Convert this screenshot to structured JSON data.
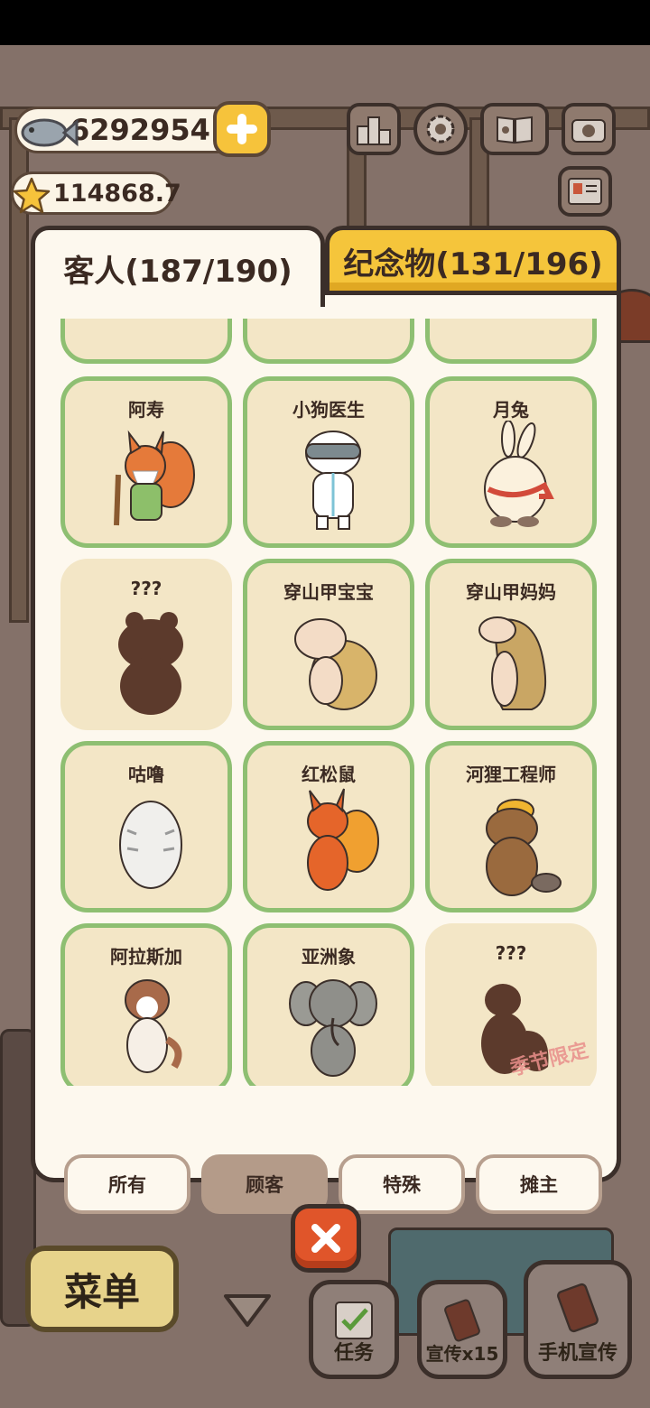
{
  "currency": {
    "fish": "6292954",
    "stars": "114868.7"
  },
  "top_icons": [
    "ranking-icon",
    "gear-icon",
    "album-icon",
    "camera-icon",
    "profile-card-icon"
  ],
  "tabs": {
    "guests": "客人(187/190)",
    "souvenirs": "纪念物(131/196)"
  },
  "cards": [
    {
      "name": "阿寿",
      "locked": false
    },
    {
      "name": "小狗医生",
      "locked": false
    },
    {
      "name": "月兔",
      "locked": false
    },
    {
      "name": "???",
      "locked": true
    },
    {
      "name": "穿山甲宝宝",
      "locked": false
    },
    {
      "name": "穿山甲妈妈",
      "locked": false
    },
    {
      "name": "咕噜",
      "locked": false
    },
    {
      "name": "红松鼠",
      "locked": false
    },
    {
      "name": "河狸工程师",
      "locked": false
    },
    {
      "name": "阿拉斯加",
      "locked": false
    },
    {
      "name": "亚洲象",
      "locked": false
    },
    {
      "name": "???",
      "locked": true,
      "stamp": "季节限定"
    }
  ],
  "filters": [
    {
      "label": "所有",
      "active": false
    },
    {
      "label": "顾客",
      "active": true
    },
    {
      "label": "特殊",
      "active": false
    },
    {
      "label": "摊主",
      "active": false
    }
  ],
  "bottom": {
    "menu": "菜单",
    "task": "任务",
    "promo": "宣传x15",
    "phone_promo": "手机宣传"
  },
  "colors": {
    "card_border": "#8ebf72",
    "card_bg": "#f3e6c6",
    "tab_inactive": "#f5c53b",
    "close": "#e0552a"
  }
}
